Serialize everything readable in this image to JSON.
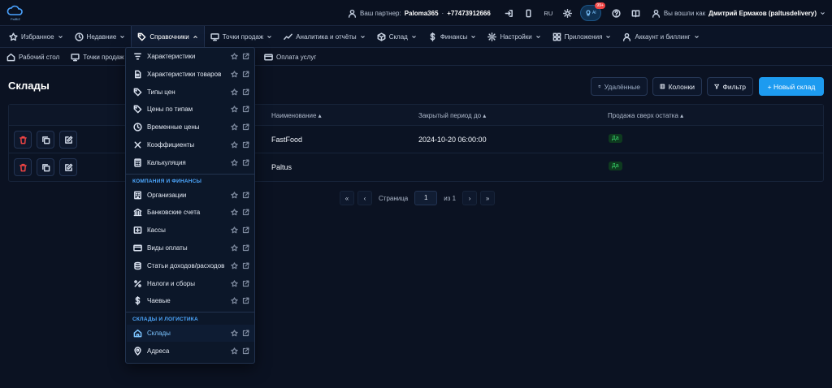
{
  "app": {
    "logo_text": "PalBIZ"
  },
  "topbar": {
    "partner_label": "Ваш партнер:",
    "partner_name": "Paloma365",
    "partner_phone": "+77473912666",
    "lang": "RU",
    "ai_label": "AI",
    "ai_badge": "99+",
    "user_label": "Вы вошли как",
    "user_name": "Дмитрий Ермаков (paltusdelivery)"
  },
  "nav": {
    "items": [
      {
        "label": "Избранное",
        "icon": "star-icon"
      },
      {
        "label": "Недавние",
        "icon": "clock-icon"
      },
      {
        "label": "Справочники",
        "icon": "tag-icon"
      },
      {
        "label": "Точки продаж",
        "icon": "monitor-icon"
      },
      {
        "label": "Аналитика и отчёты",
        "icon": "chart-icon"
      },
      {
        "label": "Склад",
        "icon": "box-icon"
      },
      {
        "label": "Финансы",
        "icon": "dollar-icon"
      },
      {
        "label": "Настройки",
        "icon": "gear-icon"
      },
      {
        "label": "Приложения",
        "icon": "grid-icon"
      },
      {
        "label": "Аккаунт и биллинг",
        "icon": "user-icon"
      }
    ]
  },
  "crumbs": {
    "items": [
      "Рабочий стол",
      "Точки продаж"
    ],
    "right": "Оплата услуг"
  },
  "page": {
    "title": "Склады",
    "btn_deleted": "Удалённые",
    "btn_columns": "Колонки",
    "btn_filter": "Фильтр",
    "btn_new": "+ Новый склад"
  },
  "table": {
    "headers": [
      "Наименование ▴",
      "Закрытый период до ▴",
      "Продажа сверх остатка ▴"
    ],
    "rows": [
      {
        "name": "FastFood",
        "period": "2024-10-20 06:00:00",
        "oversell": "Да"
      },
      {
        "name": "Paltus",
        "period": "",
        "oversell": "Да"
      }
    ]
  },
  "pager": {
    "first": "«",
    "prev": "‹",
    "page_label": "Страница",
    "page": "1",
    "of_label": "из 1",
    "next": "›",
    "last": "»"
  },
  "menu": {
    "items_top": [
      {
        "label": "Характеристики",
        "icon": "filter-lines-icon"
      },
      {
        "label": "Характеристики товаров",
        "icon": "document-icon"
      },
      {
        "label": "Типы цен",
        "icon": "tag-icon"
      },
      {
        "label": "Цены по типам",
        "icon": "tag-icon"
      },
      {
        "label": "Временные цены",
        "icon": "clock-icon"
      },
      {
        "label": "Коэффициенты",
        "icon": "x-icon"
      },
      {
        "label": "Калькуляция",
        "icon": "calculator-icon"
      }
    ],
    "section_company": "КОМПАНИЯ И ФИНАНСЫ",
    "items_company": [
      {
        "label": "Организации",
        "icon": "building-icon"
      },
      {
        "label": "Банковские счета",
        "icon": "bank-icon"
      },
      {
        "label": "Кассы",
        "icon": "cash-register-icon"
      },
      {
        "label": "Виды оплаты",
        "icon": "card-icon"
      },
      {
        "label": "Статьи доходов/расходов",
        "icon": "coins-icon"
      },
      {
        "label": "Налоги и сборы",
        "icon": "percent-icon"
      },
      {
        "label": "Чаевые",
        "icon": "dollar-icon"
      }
    ],
    "section_warehouse": "СКЛАДЫ И ЛОГИСТИКА",
    "items_warehouse": [
      {
        "label": "Склады",
        "icon": "home-icon"
      },
      {
        "label": "Адреса",
        "icon": "pin-icon"
      }
    ]
  }
}
